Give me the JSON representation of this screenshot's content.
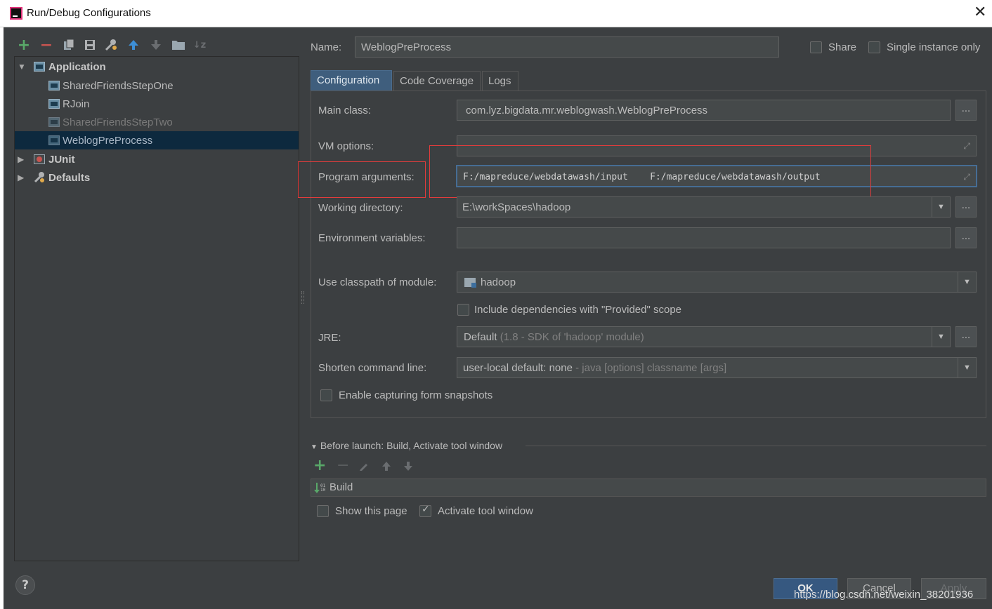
{
  "window": {
    "title": "Run/Debug Configurations",
    "close_glyph": "✕"
  },
  "toolbar": {
    "icons": [
      "add-icon",
      "remove-icon",
      "copy-icon",
      "save-icon",
      "wrench-icon",
      "move-up-icon",
      "move-down-icon",
      "folder-icon",
      "sort-icon"
    ]
  },
  "tree": {
    "items": [
      {
        "label": "Application",
        "level": 0,
        "expanded": true,
        "bold": true
      },
      {
        "label": "SharedFriendsStepOne",
        "level": 1
      },
      {
        "label": "RJoin",
        "level": 1
      },
      {
        "label": "SharedFriendsStepTwo",
        "level": 1,
        "dimmed": true
      },
      {
        "label": "WeblogPreProcess",
        "level": 1,
        "selected": true
      },
      {
        "label": "JUnit",
        "level": 0,
        "expanded": false,
        "bold": true
      },
      {
        "label": "Defaults",
        "level": 0,
        "expanded": false,
        "bold": true
      }
    ]
  },
  "header": {
    "name_label": "Name:",
    "name_value": "WeblogPreProcess",
    "share_label": "Share",
    "single_instance_label": "Single instance only"
  },
  "tabs": [
    "Configuration",
    "Code Coverage",
    "Logs"
  ],
  "form": {
    "main_class_label": "Main class:",
    "main_class_value": "com.lyz.bigdata.mr.weblogwash.WeblogPreProcess",
    "vm_options_label": "VM options:",
    "vm_options_value": "",
    "program_args_label": "Program arguments:",
    "program_args_value": "F:/mapreduce/webdatawash/input    F:/mapreduce/webdatawash/output",
    "working_dir_label": "Working directory:",
    "working_dir_value": "E:\\workSpaces\\hadoop",
    "env_vars_label": "Environment variables:",
    "env_vars_value": "",
    "classpath_label": "Use classpath of module:",
    "classpath_value": "hadoop",
    "include_deps_label": "Include dependencies with \"Provided\" scope",
    "jre_label": "JRE:",
    "jre_value": "Default",
    "jre_hint": "(1.8 - SDK of 'hadoop' module)",
    "shorten_label": "Shorten command line:",
    "shorten_value": "user-local default: none",
    "shorten_hint": "- java [options] classname [args]",
    "snapshots_label": "Enable capturing form snapshots",
    "dots": "..."
  },
  "before_launch": {
    "title": "Before launch: Build, Activate tool window",
    "task": "Build"
  },
  "footer": {
    "show_page_label": "Show this page",
    "activate_label": "Activate tool window",
    "ok_label": "OK",
    "cancel_label": "Cancel",
    "apply_label": "Apply",
    "help_glyph": "?",
    "watermark": "https://blog.csdn.net/weixin_38201936"
  },
  "colors": {
    "add_green": "#59a869",
    "remove_red": "#c75450",
    "accent_blue": "#3f5e7d",
    "annotation_red": "#e23c3c"
  }
}
